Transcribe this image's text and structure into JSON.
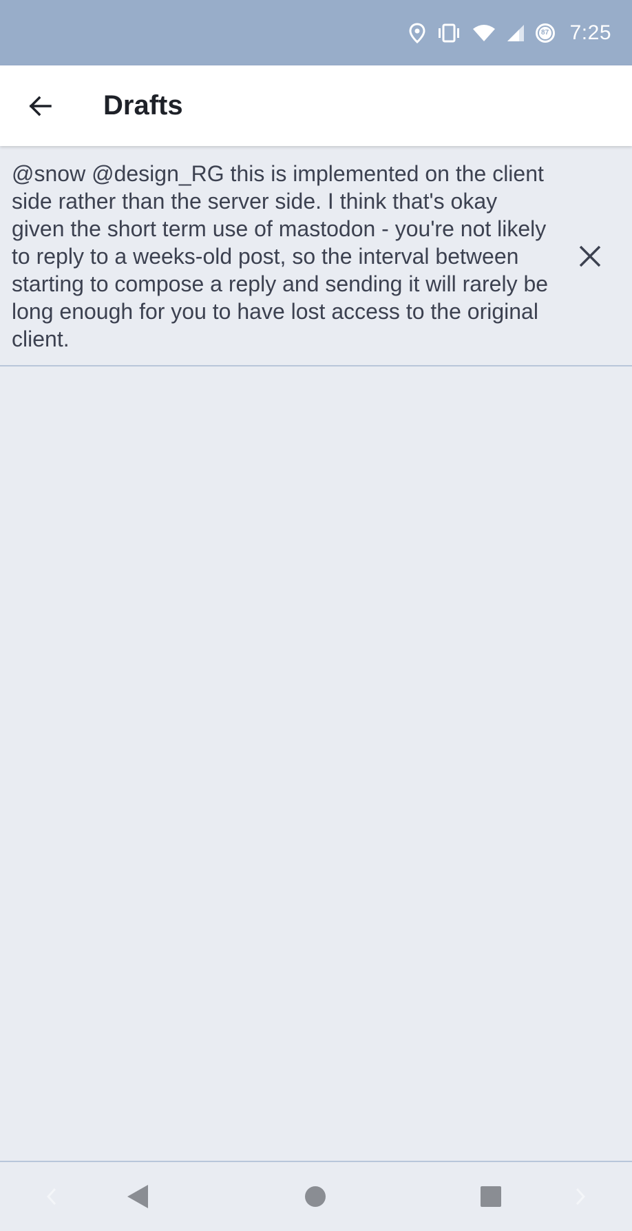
{
  "status_bar": {
    "time": "7:25",
    "battery_level": "87",
    "icons": [
      "location-icon",
      "vibrate-icon",
      "wifi-icon",
      "signal-icon",
      "battery-icon"
    ]
  },
  "app_bar": {
    "title": "Drafts",
    "back_icon": "arrow-left-icon"
  },
  "drafts": [
    {
      "text": "@snow @design_RG this is implemented on the client side rather than the server side. I think that's okay given the short term use of mastodon - you're not likely to reply to a weeks-old post, so the interval between starting to compose a reply and sending it will rarely be long enough for you to have lost access to the original client.",
      "delete_icon": "close-icon"
    }
  ],
  "nav_bar": {
    "icons": [
      "chevron-left-icon",
      "back-triangle-icon",
      "home-circle-icon",
      "recents-square-icon",
      "chevron-right-icon"
    ]
  },
  "colors": {
    "status_bar": "#98adc9",
    "background": "#e9ecf2",
    "app_bar": "#ffffff",
    "text": "#3c4150",
    "divider": "#b8c6da"
  }
}
